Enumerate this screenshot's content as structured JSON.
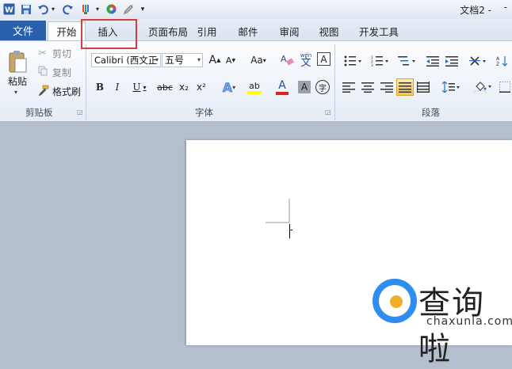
{
  "window": {
    "title": "文档2 -",
    "minimize": "-"
  },
  "quick_access": {
    "app_icon": "W",
    "save_icon": "floppy-disk-icon",
    "undo_icon": "undo-icon",
    "redo_icon": "redo-icon",
    "customize": "▾"
  },
  "tabs": {
    "file": "文件",
    "home": "开始",
    "insert": "插入",
    "page_layout": "页面布局",
    "references": "引用",
    "mailings": "邮件",
    "review": "审阅",
    "view": "视图",
    "developer": "开发工具"
  },
  "clipboard": {
    "paste": "粘贴",
    "cut": "剪切",
    "copy": "复制",
    "format_painter": "格式刷",
    "group_label": "剪贴板"
  },
  "font": {
    "font_name": "Calibri (西文正",
    "font_size": "五号",
    "grow": "A",
    "shrink": "A",
    "change_case": "Aa",
    "clear_format": "A",
    "phonetic": "wén 文",
    "border": "A",
    "bold": "B",
    "italic": "I",
    "underline": "U",
    "strike": "abc",
    "subscript": "x₂",
    "superscript": "x²",
    "text_effect": "A",
    "highlight": "ab",
    "font_color": "A",
    "char_shading": "A",
    "enclose": "字",
    "group_label": "字体"
  },
  "paragraph": {
    "group_label": "段落"
  },
  "colors": {
    "accent": "#2a5fac",
    "highlight_box": "#d63d3d",
    "watermark_blue": "#2f8df0",
    "watermark_orange": "#f0b02a"
  },
  "watermark": {
    "brand": "查询啦",
    "url": "chaxunla.com"
  }
}
